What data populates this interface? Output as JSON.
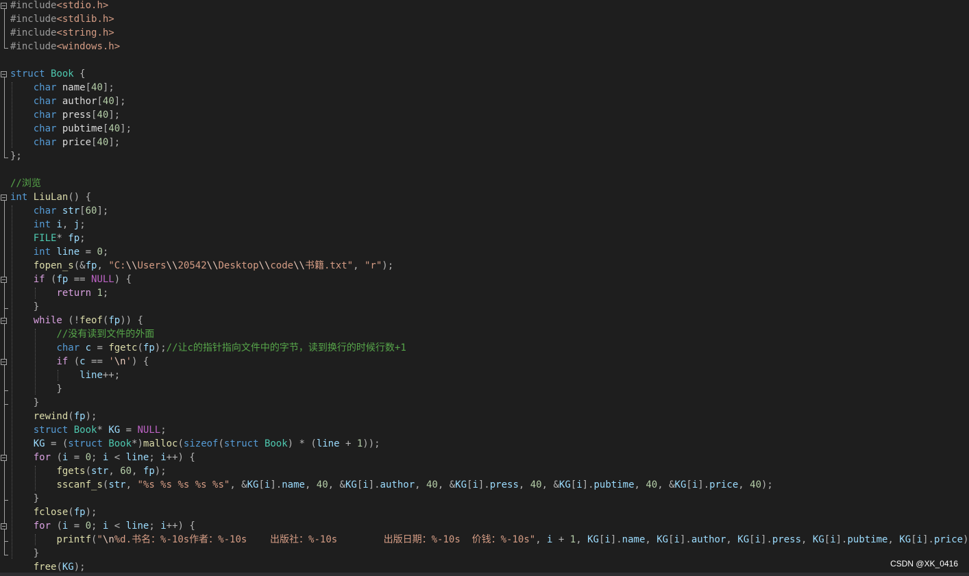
{
  "colors": {
    "background": "#1e1e1e",
    "keyword": "#569cd6",
    "control_keyword": "#d8a0df",
    "type": "#4ec9b0",
    "string": "#d69d85",
    "comment": "#57a64a",
    "function": "#dcdcaa",
    "variable": "#9cdcfe",
    "macro": "#bd63c5"
  },
  "code_lines": [
    [
      [
        "pre",
        "#include"
      ],
      [
        "inc",
        "<stdio.h>"
      ]
    ],
    [
      [
        "pre",
        "#include"
      ],
      [
        "inc",
        "<stdlib.h>"
      ]
    ],
    [
      [
        "pre",
        "#include"
      ],
      [
        "inc",
        "<string.h>"
      ]
    ],
    [
      [
        "pre",
        "#include"
      ],
      [
        "inc",
        "<windows.h>"
      ]
    ],
    [],
    [
      [
        "kw",
        "struct"
      ],
      [
        "id",
        " "
      ],
      [
        "typ",
        "Book"
      ],
      [
        "pl",
        " {"
      ]
    ],
    [
      [
        "id",
        "    "
      ],
      [
        "kw",
        "char"
      ],
      [
        "id",
        " name"
      ],
      [
        "pl",
        "["
      ],
      [
        "num",
        "40"
      ],
      [
        "pl",
        "];"
      ]
    ],
    [
      [
        "id",
        "    "
      ],
      [
        "kw",
        "char"
      ],
      [
        "id",
        " author"
      ],
      [
        "pl",
        "["
      ],
      [
        "num",
        "40"
      ],
      [
        "pl",
        "];"
      ]
    ],
    [
      [
        "id",
        "    "
      ],
      [
        "kw",
        "char"
      ],
      [
        "id",
        " press"
      ],
      [
        "pl",
        "["
      ],
      [
        "num",
        "40"
      ],
      [
        "pl",
        "];"
      ]
    ],
    [
      [
        "id",
        "    "
      ],
      [
        "kw",
        "char"
      ],
      [
        "id",
        " pubtime"
      ],
      [
        "pl",
        "["
      ],
      [
        "num",
        "40"
      ],
      [
        "pl",
        "];"
      ]
    ],
    [
      [
        "id",
        "    "
      ],
      [
        "kw",
        "char"
      ],
      [
        "id",
        " price"
      ],
      [
        "pl",
        "["
      ],
      [
        "num",
        "40"
      ],
      [
        "pl",
        "];"
      ]
    ],
    [
      [
        "pl",
        "};"
      ]
    ],
    [],
    [
      [
        "cmt",
        "//浏览"
      ]
    ],
    [
      [
        "kw",
        "int"
      ],
      [
        "id",
        " "
      ],
      [
        "fn",
        "LiuLan"
      ],
      [
        "pl",
        "() {"
      ]
    ],
    [
      [
        "id",
        "    "
      ],
      [
        "kw",
        "char"
      ],
      [
        "id",
        " "
      ],
      [
        "var",
        "str"
      ],
      [
        "pl",
        "["
      ],
      [
        "num",
        "60"
      ],
      [
        "pl",
        "];"
      ]
    ],
    [
      [
        "id",
        "    "
      ],
      [
        "kw",
        "int"
      ],
      [
        "id",
        " "
      ],
      [
        "var",
        "i"
      ],
      [
        "pl",
        ", "
      ],
      [
        "var",
        "j"
      ],
      [
        "pl",
        ";"
      ]
    ],
    [
      [
        "id",
        "    "
      ],
      [
        "typ",
        "FILE"
      ],
      [
        "pl",
        "* "
      ],
      [
        "var",
        "fp"
      ],
      [
        "pl",
        ";"
      ]
    ],
    [
      [
        "id",
        "    "
      ],
      [
        "kw",
        "int"
      ],
      [
        "id",
        " "
      ],
      [
        "var",
        "line"
      ],
      [
        "pl",
        " = "
      ],
      [
        "num",
        "0"
      ],
      [
        "pl",
        ";"
      ]
    ],
    [
      [
        "id",
        "    "
      ],
      [
        "fn",
        "fopen_s"
      ],
      [
        "pl",
        "(&"
      ],
      [
        "var",
        "fp"
      ],
      [
        "pl",
        ", "
      ],
      [
        "str",
        "\"C:"
      ],
      [
        "esc",
        "\\\\"
      ],
      [
        "str",
        "Users"
      ],
      [
        "esc",
        "\\\\"
      ],
      [
        "str",
        "20542"
      ],
      [
        "esc",
        "\\\\"
      ],
      [
        "str",
        "Desktop"
      ],
      [
        "esc",
        "\\\\"
      ],
      [
        "str",
        "code"
      ],
      [
        "esc",
        "\\\\"
      ],
      [
        "str",
        "书籍.txt\""
      ],
      [
        "pl",
        ", "
      ],
      [
        "str",
        "\"r\""
      ],
      [
        "pl",
        ");"
      ]
    ],
    [
      [
        "id",
        "    "
      ],
      [
        "ctl",
        "if"
      ],
      [
        "pl",
        " ("
      ],
      [
        "var",
        "fp"
      ],
      [
        "pl",
        " == "
      ],
      [
        "mac",
        "NULL"
      ],
      [
        "pl",
        ") {"
      ]
    ],
    [
      [
        "id",
        "        "
      ],
      [
        "ctl",
        "return"
      ],
      [
        "pl",
        " "
      ],
      [
        "num",
        "1"
      ],
      [
        "pl",
        ";"
      ]
    ],
    [
      [
        "id",
        "    "
      ],
      [
        "pl",
        "}"
      ]
    ],
    [
      [
        "id",
        "    "
      ],
      [
        "ctl",
        "while"
      ],
      [
        "pl",
        " (!"
      ],
      [
        "fn",
        "feof"
      ],
      [
        "pl",
        "("
      ],
      [
        "var",
        "fp"
      ],
      [
        "pl",
        ")) {"
      ]
    ],
    [
      [
        "id",
        "        "
      ],
      [
        "cmt",
        "//没有读到文件的外面"
      ]
    ],
    [
      [
        "id",
        "        "
      ],
      [
        "kw",
        "char"
      ],
      [
        "id",
        " "
      ],
      [
        "var",
        "c"
      ],
      [
        "pl",
        " = "
      ],
      [
        "fn",
        "fgetc"
      ],
      [
        "pl",
        "("
      ],
      [
        "var",
        "fp"
      ],
      [
        "pl",
        ");"
      ],
      [
        "cmt",
        "//让c的指针指向文件中的字节，读到换行的时候行数+1"
      ]
    ],
    [
      [
        "id",
        "        "
      ],
      [
        "ctl",
        "if"
      ],
      [
        "pl",
        " ("
      ],
      [
        "var",
        "c"
      ],
      [
        "pl",
        " == "
      ],
      [
        "str",
        "'"
      ],
      [
        "esc",
        "\\n"
      ],
      [
        "str",
        "'"
      ],
      [
        "pl",
        ") {"
      ]
    ],
    [
      [
        "id",
        "            "
      ],
      [
        "var",
        "line"
      ],
      [
        "pl",
        "++;"
      ]
    ],
    [
      [
        "id",
        "        "
      ],
      [
        "pl",
        "}"
      ]
    ],
    [
      [
        "id",
        "    "
      ],
      [
        "pl",
        "}"
      ]
    ],
    [
      [
        "id",
        "    "
      ],
      [
        "fn",
        "rewind"
      ],
      [
        "pl",
        "("
      ],
      [
        "var",
        "fp"
      ],
      [
        "pl",
        ");"
      ]
    ],
    [
      [
        "id",
        "    "
      ],
      [
        "kw",
        "struct"
      ],
      [
        "id",
        " "
      ],
      [
        "typ",
        "Book"
      ],
      [
        "pl",
        "* "
      ],
      [
        "var",
        "KG"
      ],
      [
        "pl",
        " = "
      ],
      [
        "mac",
        "NULL"
      ],
      [
        "pl",
        ";"
      ]
    ],
    [
      [
        "id",
        "    "
      ],
      [
        "var",
        "KG"
      ],
      [
        "pl",
        " = ("
      ],
      [
        "kw",
        "struct"
      ],
      [
        "id",
        " "
      ],
      [
        "typ",
        "Book"
      ],
      [
        "pl",
        "*)"
      ],
      [
        "fn",
        "malloc"
      ],
      [
        "pl",
        "("
      ],
      [
        "kw",
        "sizeof"
      ],
      [
        "pl",
        "("
      ],
      [
        "kw",
        "struct"
      ],
      [
        "id",
        " "
      ],
      [
        "typ",
        "Book"
      ],
      [
        "pl",
        ") * ("
      ],
      [
        "var",
        "line"
      ],
      [
        "pl",
        " + "
      ],
      [
        "num",
        "1"
      ],
      [
        "pl",
        "));"
      ]
    ],
    [
      [
        "id",
        "    "
      ],
      [
        "ctl",
        "for"
      ],
      [
        "pl",
        " ("
      ],
      [
        "var",
        "i"
      ],
      [
        "pl",
        " = "
      ],
      [
        "num",
        "0"
      ],
      [
        "pl",
        "; "
      ],
      [
        "var",
        "i"
      ],
      [
        "pl",
        " < "
      ],
      [
        "var",
        "line"
      ],
      [
        "pl",
        "; "
      ],
      [
        "var",
        "i"
      ],
      [
        "pl",
        "++) {"
      ]
    ],
    [
      [
        "id",
        "        "
      ],
      [
        "fn",
        "fgets"
      ],
      [
        "pl",
        "("
      ],
      [
        "var",
        "str"
      ],
      [
        "pl",
        ", "
      ],
      [
        "num",
        "60"
      ],
      [
        "pl",
        ", "
      ],
      [
        "var",
        "fp"
      ],
      [
        "pl",
        ");"
      ]
    ],
    [
      [
        "id",
        "        "
      ],
      [
        "fn",
        "sscanf_s"
      ],
      [
        "pl",
        "("
      ],
      [
        "var",
        "str"
      ],
      [
        "pl",
        ", "
      ],
      [
        "str",
        "\"%s %s %s %s %s\""
      ],
      [
        "pl",
        ", &"
      ],
      [
        "var",
        "KG"
      ],
      [
        "pl",
        "["
      ],
      [
        "var",
        "i"
      ],
      [
        "pl",
        "]."
      ],
      [
        "var",
        "name"
      ],
      [
        "pl",
        ", "
      ],
      [
        "num",
        "40"
      ],
      [
        "pl",
        ", &"
      ],
      [
        "var",
        "KG"
      ],
      [
        "pl",
        "["
      ],
      [
        "var",
        "i"
      ],
      [
        "pl",
        "]."
      ],
      [
        "var",
        "author"
      ],
      [
        "pl",
        ", "
      ],
      [
        "num",
        "40"
      ],
      [
        "pl",
        ", &"
      ],
      [
        "var",
        "KG"
      ],
      [
        "pl",
        "["
      ],
      [
        "var",
        "i"
      ],
      [
        "pl",
        "]."
      ],
      [
        "var",
        "press"
      ],
      [
        "pl",
        ", "
      ],
      [
        "num",
        "40"
      ],
      [
        "pl",
        ", &"
      ],
      [
        "var",
        "KG"
      ],
      [
        "pl",
        "["
      ],
      [
        "var",
        "i"
      ],
      [
        "pl",
        "]."
      ],
      [
        "var",
        "pubtime"
      ],
      [
        "pl",
        ", "
      ],
      [
        "num",
        "40"
      ],
      [
        "pl",
        ", &"
      ],
      [
        "var",
        "KG"
      ],
      [
        "pl",
        "["
      ],
      [
        "var",
        "i"
      ],
      [
        "pl",
        "]."
      ],
      [
        "var",
        "price"
      ],
      [
        "pl",
        ", "
      ],
      [
        "num",
        "40"
      ],
      [
        "pl",
        ");"
      ]
    ],
    [
      [
        "id",
        "    "
      ],
      [
        "pl",
        "}"
      ]
    ],
    [
      [
        "id",
        "    "
      ],
      [
        "fn",
        "fclose"
      ],
      [
        "pl",
        "("
      ],
      [
        "var",
        "fp"
      ],
      [
        "pl",
        ");"
      ]
    ],
    [
      [
        "id",
        "    "
      ],
      [
        "ctl",
        "for"
      ],
      [
        "pl",
        " ("
      ],
      [
        "var",
        "i"
      ],
      [
        "pl",
        " = "
      ],
      [
        "num",
        "0"
      ],
      [
        "pl",
        "; "
      ],
      [
        "var",
        "i"
      ],
      [
        "pl",
        " < "
      ],
      [
        "var",
        "line"
      ],
      [
        "pl",
        "; "
      ],
      [
        "var",
        "i"
      ],
      [
        "pl",
        "++) {"
      ]
    ],
    [
      [
        "id",
        "        "
      ],
      [
        "fn",
        "printf"
      ],
      [
        "pl",
        "("
      ],
      [
        "str",
        "\""
      ],
      [
        "esc",
        "\\n"
      ],
      [
        "str",
        "%d.书名：%-10s作者：%-10s    出版社：%-10s        出版日期：%-10s  价钱：%-10s\""
      ],
      [
        "pl",
        ", "
      ],
      [
        "var",
        "i"
      ],
      [
        "pl",
        " + "
      ],
      [
        "num",
        "1"
      ],
      [
        "pl",
        ", "
      ],
      [
        "var",
        "KG"
      ],
      [
        "pl",
        "["
      ],
      [
        "var",
        "i"
      ],
      [
        "pl",
        "]."
      ],
      [
        "var",
        "name"
      ],
      [
        "pl",
        ", "
      ],
      [
        "var",
        "KG"
      ],
      [
        "pl",
        "["
      ],
      [
        "var",
        "i"
      ],
      [
        "pl",
        "]."
      ],
      [
        "var",
        "author"
      ],
      [
        "pl",
        ", "
      ],
      [
        "var",
        "KG"
      ],
      [
        "pl",
        "["
      ],
      [
        "var",
        "i"
      ],
      [
        "pl",
        "]."
      ],
      [
        "var",
        "press"
      ],
      [
        "pl",
        ", "
      ],
      [
        "var",
        "KG"
      ],
      [
        "pl",
        "["
      ],
      [
        "var",
        "i"
      ],
      [
        "pl",
        "]."
      ],
      [
        "var",
        "pubtime"
      ],
      [
        "pl",
        ", "
      ],
      [
        "var",
        "KG"
      ],
      [
        "pl",
        "["
      ],
      [
        "var",
        "i"
      ],
      [
        "pl",
        "]."
      ],
      [
        "var",
        "price"
      ],
      [
        "pl",
        ");"
      ]
    ],
    [
      [
        "id",
        "    "
      ],
      [
        "pl",
        "}"
      ]
    ],
    [
      [
        "id",
        "    "
      ],
      [
        "fn",
        "free"
      ],
      [
        "pl",
        "("
      ],
      [
        "var",
        "KG"
      ],
      [
        "pl",
        ");"
      ]
    ]
  ],
  "watermark": "CSDN @XK_0416"
}
